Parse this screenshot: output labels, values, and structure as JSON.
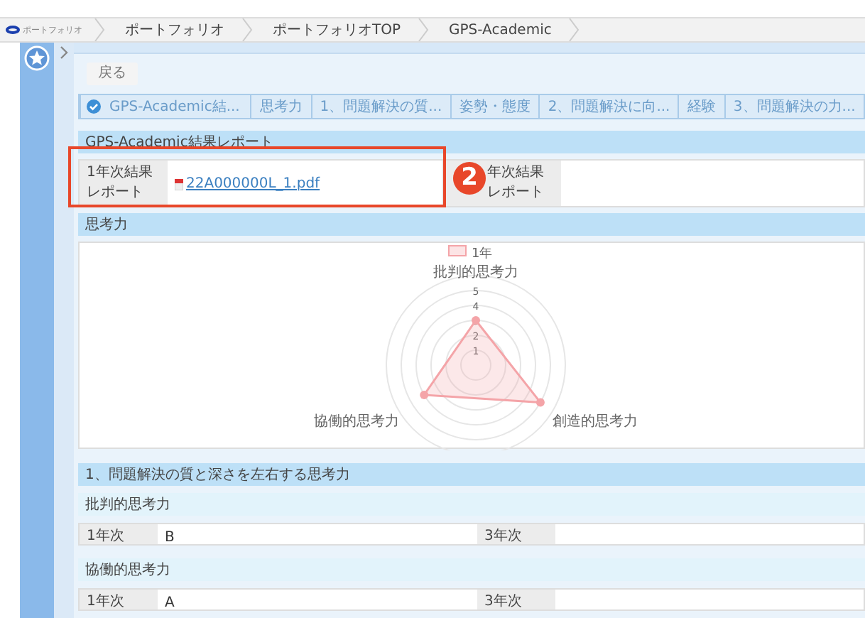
{
  "breadcrumb": {
    "logo_text": "ポートフォリオ",
    "items": [
      "ポートフォリオ",
      "ポートフォリオTOP",
      "GPS-Academic"
    ]
  },
  "back_button": "戻る",
  "steps": [
    {
      "label": "GPS-Academic結...",
      "done": true
    },
    {
      "label": "思考力",
      "done": false
    },
    {
      "label": "1、問題解決の質...",
      "done": false
    },
    {
      "label": "姿勢・態度",
      "done": false
    },
    {
      "label": "2、問題解決に向...",
      "done": false
    },
    {
      "label": "経験",
      "done": false
    },
    {
      "label": "3、問題解決の力...",
      "done": false
    }
  ],
  "report_section": {
    "title": "GPS-Academic結果レポート",
    "label_1": "1年次結果レポート",
    "file_link": "22A000000L_1.pdf",
    "label_3": "年次結果レポート"
  },
  "annotation": {
    "number": "2"
  },
  "thinking_section": {
    "title": "思考力",
    "chart_data": {
      "type": "radar",
      "categories": [
        "批判的思考力",
        "創造的思考力",
        "協働的思考力"
      ],
      "yticks": [
        1,
        2,
        3,
        4,
        5
      ],
      "ylim": [
        0,
        6
      ],
      "series": [
        {
          "name": "1年",
          "color": "#f4a4a8",
          "values": [
            3,
            5,
            4
          ]
        }
      ]
    }
  },
  "problem_section": {
    "title": "1、問題解決の質と深さを左右する思考力",
    "items": [
      {
        "title": "批判的思考力",
        "label_1": "1年次",
        "value_1": "B",
        "label_3": "3年次"
      },
      {
        "title": "協働的思考力",
        "label_1": "1年次",
        "value_1": "A",
        "label_3": "3年次"
      }
    ]
  }
}
